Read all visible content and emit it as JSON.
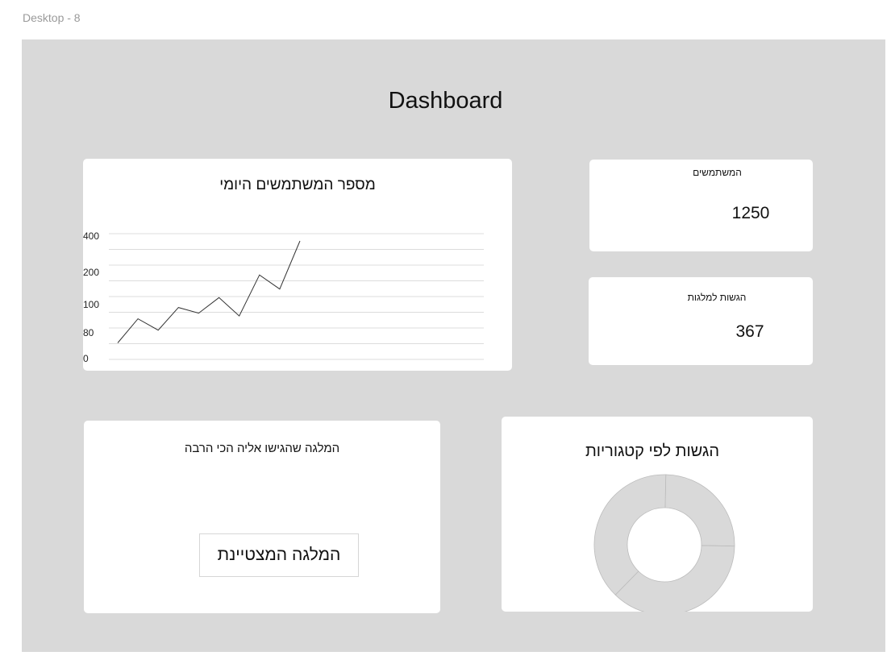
{
  "frame": {
    "label": "Desktop - 8"
  },
  "dashboard": {
    "title": "Dashboard"
  },
  "daily_users": {
    "title": "מספר המשתמשים היומי",
    "y_tick_labels": [
      "400",
      "200",
      "100",
      "80",
      "0"
    ]
  },
  "kpis": {
    "users": {
      "label": "המשתמשים",
      "value": "1250"
    },
    "orchestra_applications": {
      "label": "הגשות למלגות",
      "value": "367"
    }
  },
  "top_scholarship": {
    "title": "המלגה שהגישו אליה הכי הרבה",
    "name": "המלגה המצטיינת"
  },
  "categories": {
    "title": "הגשות לפי קטגוריות"
  },
  "colors": {
    "frame_background": "#d9d9d9",
    "card_background": "#ffffff",
    "donut_fill": "#d9d9d9",
    "donut_divider": "#bcbcbc",
    "line_color": "#333333",
    "grid_color": "#dcdcdc"
  },
  "chart_data": [
    {
      "type": "line",
      "title": "מספר המשתמשים היומי",
      "y_tick_labels": [
        "400",
        "200",
        "100",
        "80",
        "0"
      ],
      "y_scale": "ordinal-spaced ticks (visual levels 0, 80, 100, 200, 400 — spacing uneven as drawn)",
      "grid": true,
      "series": [
        {
          "values_on_tick_scale": [
            10,
            95,
            55,
            135,
            115,
            170,
            105,
            250,
            200,
            370
          ]
        }
      ]
    },
    {
      "type": "pie",
      "subtype": "donut",
      "title": "הגשות לפי קטגוריות",
      "slices": [
        {
          "share": 0.25
        },
        {
          "share": 0.37
        },
        {
          "share": 0.38
        }
      ]
    }
  ]
}
